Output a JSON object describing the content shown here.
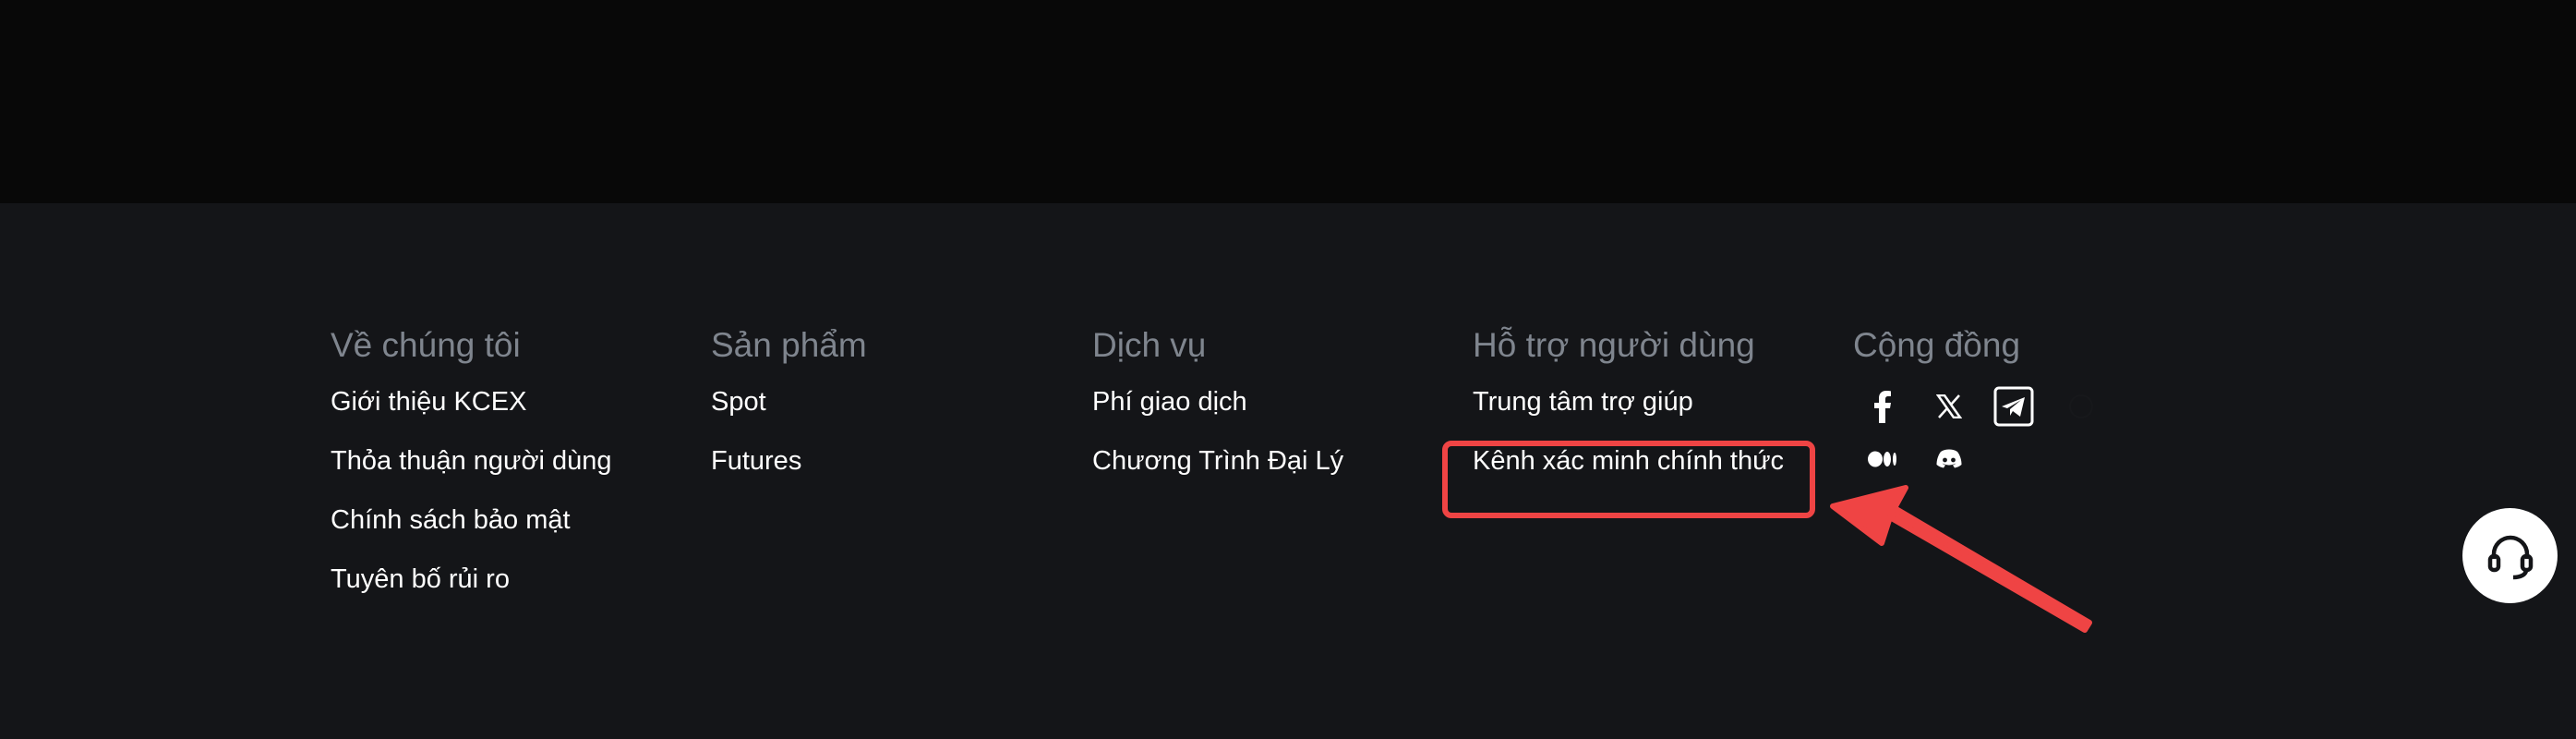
{
  "footer": {
    "columns": [
      {
        "heading": "Về chúng tôi",
        "links": [
          "Giới thiệu KCEX",
          "Thỏa thuận người dùng",
          "Chính sách bảo mật",
          "Tuyên bố rủi ro"
        ]
      },
      {
        "heading": "Sản phẩm",
        "links": [
          "Spot",
          "Futures"
        ]
      },
      {
        "heading": "Dịch vụ",
        "links": [
          "Phí giao dịch",
          "Chương Trình Đại Lý"
        ]
      },
      {
        "heading": "Hỗ trợ người dùng",
        "links": [
          "Trung tâm trợ giúp",
          "Kênh xác minh chính thức"
        ]
      }
    ],
    "community": {
      "heading": "Cộng đồng",
      "icons": [
        "facebook-icon",
        "x-twitter-icon",
        "telegram-icon",
        "hidden-icon",
        "medium-icon",
        "discord-icon"
      ]
    }
  },
  "colors": {
    "top_band": "#080808",
    "footer_bg": "#141518",
    "heading": "#7f858e",
    "link": "#ffffff",
    "annotation": "#ef4444"
  },
  "support_widget": {
    "icon": "headset-icon"
  }
}
